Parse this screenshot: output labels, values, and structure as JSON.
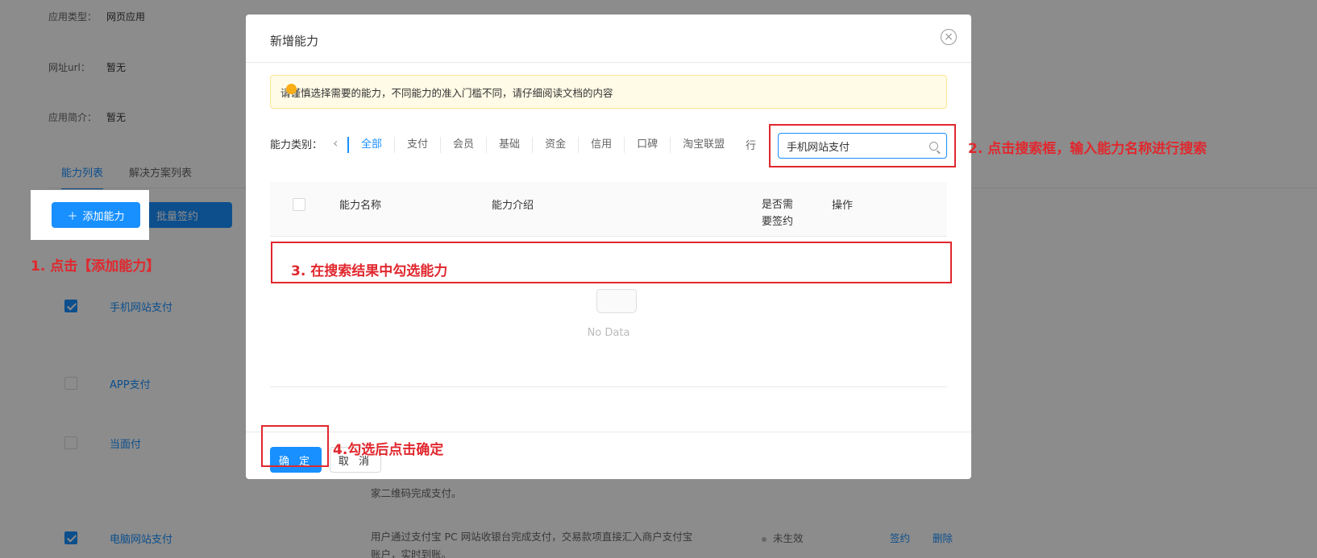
{
  "bg": {
    "app_type_label": "应用类型：",
    "app_type_value": "网页应用",
    "url_label": "网址url：",
    "url_value": "暂无",
    "intro_label": "应用简介：",
    "intro_value": "暂无",
    "tabs": [
      "能力列表",
      "解决方案列表"
    ],
    "add_button": "添加能力",
    "batch_button": "批量签约",
    "rows": [
      {
        "name": "手机网站支付",
        "checked": true
      },
      {
        "name": "APP支付",
        "checked": false
      },
      {
        "name": "当面付",
        "checked": false
      },
      {
        "name": "电脑网站支付",
        "checked": true
      }
    ],
    "desc_lines": [
      "家二维码完成支付。",
      "用户通过支付宝 PC 网站收银台完成支付，交易款项直接汇入商户支付宝",
      "账户，实时到账。"
    ],
    "status": "未生效",
    "action_sign": "签约",
    "action_delete": "删除"
  },
  "modal": {
    "title": "新增能力",
    "close": "×",
    "alert": "请谨慎选择需要的能力，不同能力的准入门槛不同，请仔细阅读文档的内容",
    "category_label": "能力类别：",
    "categories": [
      "全部",
      "支付",
      "会员",
      "基础",
      "资金",
      "信用",
      "口碑",
      "淘宝联盟"
    ],
    "category_more": "行",
    "search_value": "手机网站支付",
    "table_headers": {
      "name": "能力名称",
      "intro": "能力介绍",
      "need_sign": "是否需要签约",
      "action": "操作"
    },
    "empty_text": "No Data",
    "ok_button": "确 定",
    "cancel_button": "取 消"
  },
  "annotations": {
    "step1": "1. 点击【添加能力】",
    "step2": "2. 点击搜索框，输入能力名称进行搜索",
    "step3": "3. 在搜索结果中勾选能力",
    "step4": "4.勾选后点击确定"
  },
  "colors": {
    "primary": "#1890ff",
    "annotation": "#e0282e",
    "alert_bg": "#fffbe6"
  }
}
